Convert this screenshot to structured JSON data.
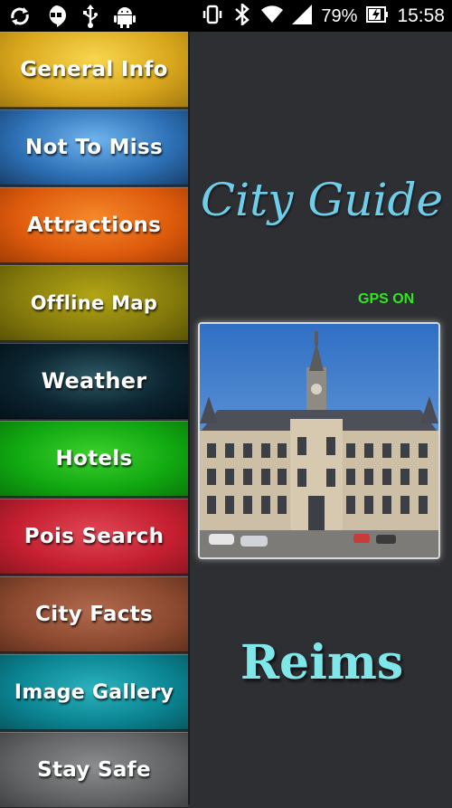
{
  "status_bar": {
    "battery_percent": "79%",
    "time": "15:58",
    "icons": [
      "sync-icon",
      "hangouts-icon",
      "usb-icon",
      "android-debug-icon",
      "vibrate-icon",
      "bluetooth-icon",
      "wifi-icon",
      "signal-icon",
      "battery-charging-icon"
    ]
  },
  "menu": {
    "items": [
      {
        "label": "General Info"
      },
      {
        "label": "Not To Miss"
      },
      {
        "label": "Attractions"
      },
      {
        "label": "Offline Map"
      },
      {
        "label": "Weather"
      },
      {
        "label": "Hotels"
      },
      {
        "label": "Pois Search"
      },
      {
        "label": "City Facts"
      },
      {
        "label": "Image Gallery"
      },
      {
        "label": "Stay Safe"
      }
    ]
  },
  "main": {
    "title": "City Guide",
    "gps_status": "GPS ON",
    "city_name": "Reims"
  },
  "colors": {
    "background": "#2e2f33",
    "title": "#6ecde8",
    "gps": "#2ee81f",
    "city": "#7fe6e9"
  }
}
